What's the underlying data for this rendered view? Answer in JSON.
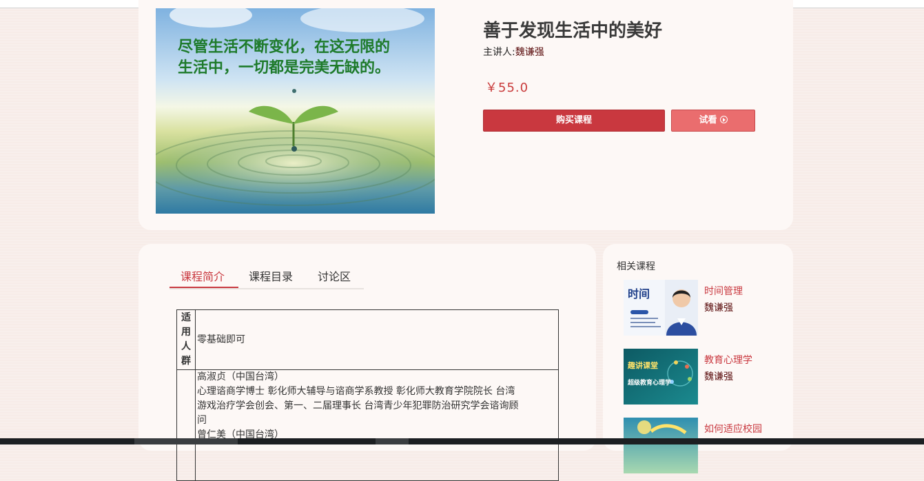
{
  "course": {
    "cover_text_line1": "尽管生活不断变化，在这无限的",
    "cover_text_line2": "生活中，一切都是完美无缺的。",
    "title": "善于发现生活中的美好",
    "lecturer_label": "主讲人:",
    "lecturer_name": "魏谦强",
    "price": "￥55.0",
    "buy_label": "购买课程",
    "preview_label": "试看"
  },
  "tabs": [
    {
      "label": "课程简介",
      "active": true
    },
    {
      "label": "课程目录",
      "active": false
    },
    {
      "label": "讨论区",
      "active": false
    }
  ],
  "intro_table": {
    "row1_header": [
      "适",
      "用",
      "人",
      "群"
    ],
    "row1_content": "零基础即可",
    "row2_lines": [
      "高淑贞（中国台湾）",
      "心理谘商学博士 彰化师大辅导与谘商学系教授 彰化师大教育学院院长 台湾",
      "游戏治疗学会创会、第一、二届理事长 台湾青少年犯罪防治研究学会谘询顾",
      "问",
      "曾仁美（中国台湾）"
    ]
  },
  "related": {
    "title": "相关课程",
    "items": [
      {
        "name": "时间管理",
        "lecturer": "魏谦强",
        "thumb_text": "时间",
        "thumb_icon": "portrait-thumbnail"
      },
      {
        "name": "教育心理学",
        "lecturer": "魏谦强",
        "thumb_text": "趣讲课堂",
        "thumb_text2": "超级教育心理学",
        "thumb_icon": "teal-brain-thumbnail"
      },
      {
        "name": "如何适应校园",
        "lecturer": "",
        "thumb_icon": "sky-thumbnail"
      }
    ]
  },
  "colors": {
    "accent": "#c9383f",
    "accent_light": "#ea6d6e",
    "lecturer_name": "#5b0e0e",
    "background": "#f7ece8",
    "panel": "#fdf8f6"
  }
}
